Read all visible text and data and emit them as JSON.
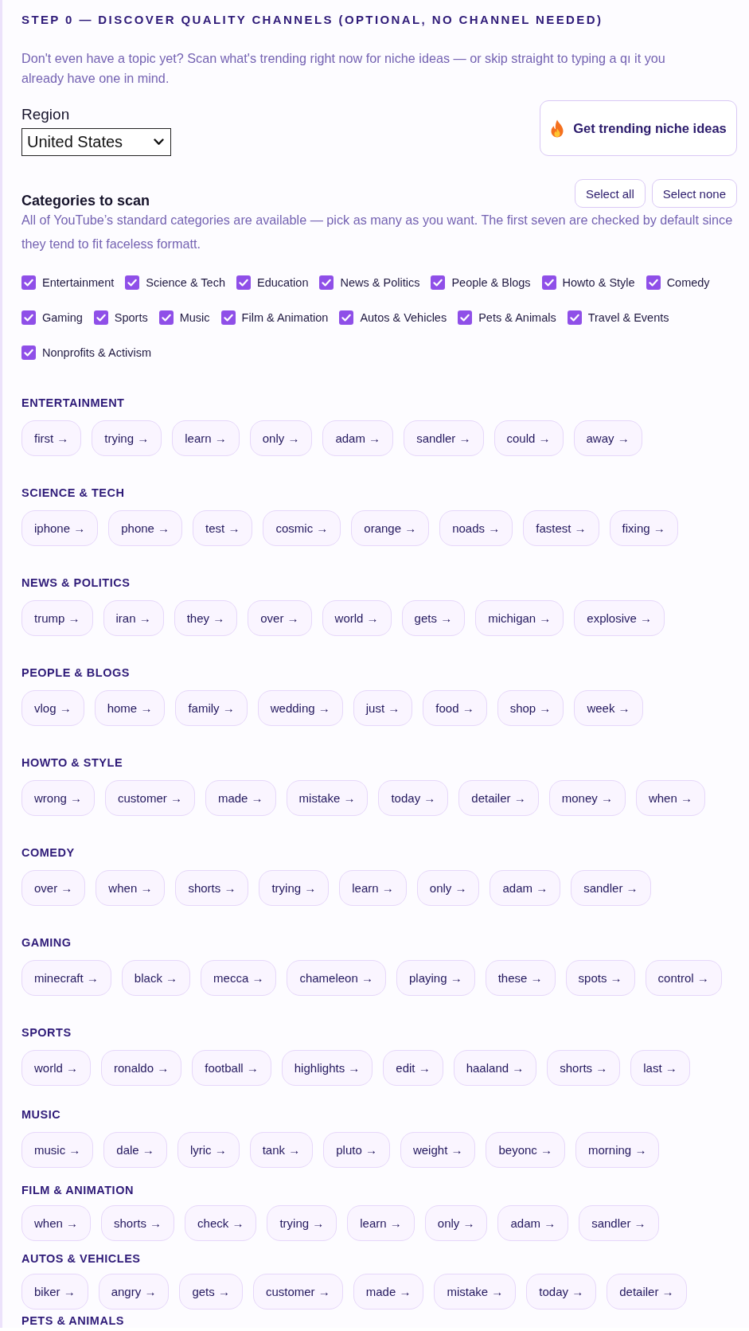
{
  "step": {
    "title": "STEP 0 — DISCOVER QUALITY CHANNELS (OPTIONAL, NO CHANNEL NEEDED)",
    "description": "Don't even have a topic yet? Scan what's trending right now for niche ideas — or skip straight to typing a qı it you already have one in mind."
  },
  "region": {
    "label": "Region",
    "value": "United States"
  },
  "trend_button": {
    "label": "Get trending niche ideas"
  },
  "categories": {
    "title": "Categories to scan",
    "buttons": [
      "Select all",
      "Select none"
    ],
    "description": "All of YouTube’s standard categories are available — pick as many as you want. The first seven are checked by default since they tend to fit faceless formatt.",
    "items": [
      {
        "label": "Entertainment",
        "checked": true
      },
      {
        "label": "Science & Tech",
        "checked": true
      },
      {
        "label": "Education",
        "checked": true
      },
      {
        "label": "News & Politics",
        "checked": true
      },
      {
        "label": "People & Blogs",
        "checked": true
      },
      {
        "label": "Howto & Style",
        "checked": true
      },
      {
        "label": "Comedy",
        "checked": true
      },
      {
        "label": "Gaming",
        "checked": true
      },
      {
        "label": "Sports",
        "checked": true
      },
      {
        "label": "Music",
        "checked": true
      },
      {
        "label": "Film & Animation",
        "checked": true
      },
      {
        "label": "Autos & Vehicles",
        "checked": true
      },
      {
        "label": "Pets & Animals",
        "checked": true
      },
      {
        "label": "Travel & Events",
        "checked": true
      },
      {
        "label": "Nonprofits & Activism",
        "checked": true
      }
    ]
  },
  "results": [
    {
      "title": "ENTERTAINMENT",
      "chips": [
        "first →",
        "trying →",
        "learn →",
        "only →",
        "adam →",
        "sandler →",
        "could →",
        "away →"
      ]
    },
    {
      "title": "SCIENCE & TECH",
      "chips": [
        "iphone →",
        "phone →",
        "test →",
        "cosmic →",
        "orange →",
        "noads →",
        "fastest →",
        "fixing →"
      ]
    },
    {
      "title": "NEWS & POLITICS",
      "chips": [
        "trump →",
        "iran →",
        "they →",
        "over →",
        "world →",
        "gets →",
        "michigan →",
        "explosive →"
      ]
    },
    {
      "title": "PEOPLE & BLOGS",
      "chips": [
        "vlog →",
        "home →",
        "family →",
        "wedding →",
        "just →",
        "food →",
        "shop →",
        "week →"
      ]
    },
    {
      "title": "HOWTO & STYLE",
      "chips": [
        "wrong →",
        "customer →",
        "made →",
        "mistake →",
        "today →",
        "detailer →",
        "money →",
        "when →"
      ]
    },
    {
      "title": "COMEDY",
      "chips": [
        "over →",
        "when →",
        "shorts →",
        "trying →",
        "learn →",
        "only →",
        "adam →",
        "sandler →"
      ]
    },
    {
      "title": "GAMING",
      "chips": [
        "minecraft →",
        "black →",
        "mecca →",
        "chameleon →",
        "playing →",
        "these →",
        "spots →",
        "control →"
      ]
    },
    {
      "title": "SPORTS",
      "chips": [
        "world →",
        "ronaldo →",
        "football →",
        "highlights →",
        "edit →",
        "haaland →",
        "shorts →",
        "last →"
      ]
    },
    {
      "title": "MUSIC",
      "chips": [
        "music →",
        "dale →",
        "lyric →",
        "tank →",
        "pluto →",
        "weight →",
        "beyonc →",
        "morning →"
      ]
    },
    {
      "title": "FILM & ANIMATION",
      "chips": [
        "when →",
        "shorts →",
        "check →",
        "trying →",
        "learn →",
        "only →",
        "adam →",
        "sandler →"
      ]
    },
    {
      "title": "AUTOS & VEHICLES",
      "chips": [
        "biker →",
        "angry →",
        "gets →",
        "customer →",
        "made →",
        "mistake →",
        "today →",
        "detailer →"
      ]
    },
    {
      "title": "PETS & ANIMALS"
    }
  ]
}
